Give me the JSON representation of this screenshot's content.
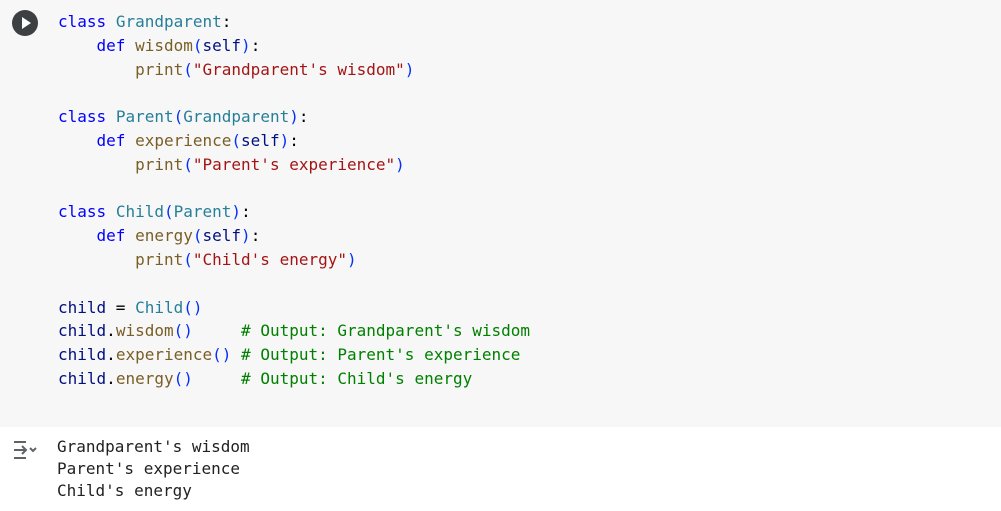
{
  "code_lines": [
    {
      "tokens": [
        {
          "t": "class",
          "c": "kw"
        },
        {
          "t": " "
        },
        {
          "t": "Grandparent",
          "c": "cls"
        },
        {
          "t": ":"
        }
      ]
    },
    {
      "tokens": [
        {
          "t": "    "
        },
        {
          "t": "def",
          "c": "kw"
        },
        {
          "t": " "
        },
        {
          "t": "wisdom",
          "c": "fn"
        },
        {
          "t": "(",
          "c": "par"
        },
        {
          "t": "self",
          "c": "self"
        },
        {
          "t": ")",
          "c": "par"
        },
        {
          "t": ":"
        }
      ]
    },
    {
      "tokens": [
        {
          "t": "        "
        },
        {
          "t": "print",
          "c": "bi"
        },
        {
          "t": "(",
          "c": "par"
        },
        {
          "t": "\"Grandparent's wisdom\"",
          "c": "str"
        },
        {
          "t": ")",
          "c": "par"
        }
      ]
    },
    {
      "tokens": []
    },
    {
      "tokens": [
        {
          "t": "class",
          "c": "kw"
        },
        {
          "t": " "
        },
        {
          "t": "Parent",
          "c": "cls"
        },
        {
          "t": "(",
          "c": "par"
        },
        {
          "t": "Grandparent",
          "c": "cls"
        },
        {
          "t": ")",
          "c": "par"
        },
        {
          "t": ":"
        }
      ]
    },
    {
      "tokens": [
        {
          "t": "    "
        },
        {
          "t": "def",
          "c": "kw"
        },
        {
          "t": " "
        },
        {
          "t": "experience",
          "c": "fn"
        },
        {
          "t": "(",
          "c": "par"
        },
        {
          "t": "self",
          "c": "self"
        },
        {
          "t": ")",
          "c": "par"
        },
        {
          "t": ":"
        }
      ]
    },
    {
      "tokens": [
        {
          "t": "        "
        },
        {
          "t": "print",
          "c": "bi"
        },
        {
          "t": "(",
          "c": "par"
        },
        {
          "t": "\"Parent's experience\"",
          "c": "str"
        },
        {
          "t": ")",
          "c": "par"
        }
      ]
    },
    {
      "tokens": []
    },
    {
      "tokens": [
        {
          "t": "class",
          "c": "kw"
        },
        {
          "t": " "
        },
        {
          "t": "Child",
          "c": "cls"
        },
        {
          "t": "(",
          "c": "par"
        },
        {
          "t": "Parent",
          "c": "cls"
        },
        {
          "t": ")",
          "c": "par"
        },
        {
          "t": ":"
        }
      ]
    },
    {
      "tokens": [
        {
          "t": "    "
        },
        {
          "t": "def",
          "c": "kw"
        },
        {
          "t": " "
        },
        {
          "t": "energy",
          "c": "fn"
        },
        {
          "t": "(",
          "c": "par"
        },
        {
          "t": "self",
          "c": "self"
        },
        {
          "t": ")",
          "c": "par"
        },
        {
          "t": ":"
        }
      ]
    },
    {
      "tokens": [
        {
          "t": "        "
        },
        {
          "t": "print",
          "c": "bi"
        },
        {
          "t": "(",
          "c": "par"
        },
        {
          "t": "\"Child's energy\"",
          "c": "str"
        },
        {
          "t": ")",
          "c": "par"
        }
      ]
    },
    {
      "tokens": []
    },
    {
      "tokens": [
        {
          "t": "child",
          "c": "var"
        },
        {
          "t": " = "
        },
        {
          "t": "Child",
          "c": "cls"
        },
        {
          "t": "()",
          "c": "par"
        }
      ]
    },
    {
      "tokens": [
        {
          "t": "child",
          "c": "var"
        },
        {
          "t": "."
        },
        {
          "t": "wisdom",
          "c": "fn"
        },
        {
          "t": "()",
          "c": "par"
        },
        {
          "t": "     "
        },
        {
          "t": "# Output: Grandparent's wisdom",
          "c": "cmt"
        }
      ]
    },
    {
      "tokens": [
        {
          "t": "child",
          "c": "var"
        },
        {
          "t": "."
        },
        {
          "t": "experience",
          "c": "fn"
        },
        {
          "t": "()",
          "c": "par"
        },
        {
          "t": " "
        },
        {
          "t": "# Output: Parent's experience",
          "c": "cmt"
        }
      ]
    },
    {
      "tokens": [
        {
          "t": "child",
          "c": "var"
        },
        {
          "t": "."
        },
        {
          "t": "energy",
          "c": "fn"
        },
        {
          "t": "()",
          "c": "par"
        },
        {
          "t": "     "
        },
        {
          "t": "# Output: Child's energy",
          "c": "cmt"
        }
      ]
    }
  ],
  "output_lines": [
    "Grandparent's wisdom",
    "Parent's experience",
    "Child's energy"
  ],
  "icons": {
    "run": "play-icon",
    "output": "output-toggle-icon"
  }
}
